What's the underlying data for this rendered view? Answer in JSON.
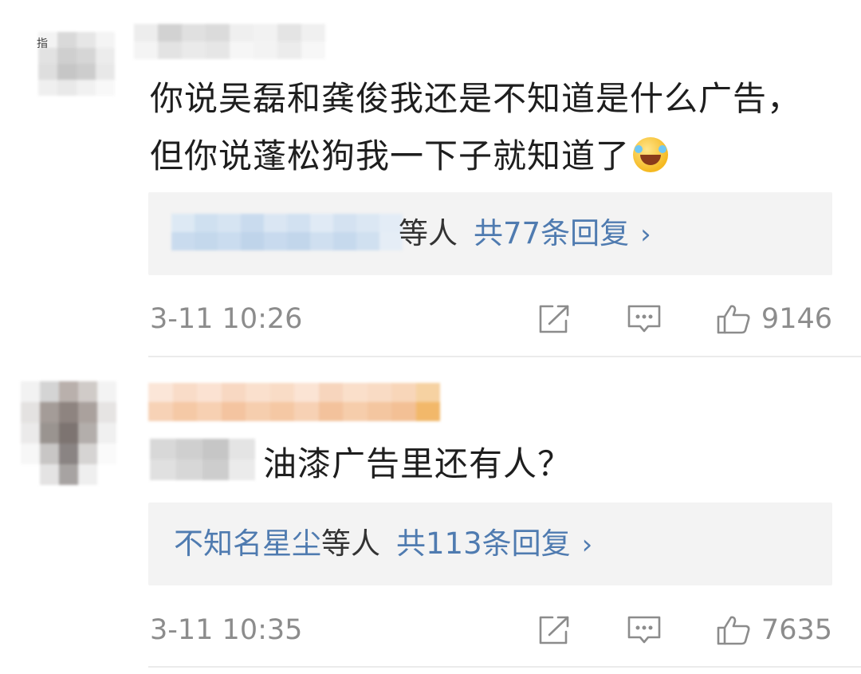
{
  "comments": [
    {
      "corner_mark": "指",
      "text": "你说吴磊和龚俊我还是不知道是什么广告，但你说蓬松狗我一下子就知道了",
      "emoji": "laughing-crying-emoji",
      "replies": {
        "name_tail": "",
        "suffix": "等人",
        "count_label": "共77条回复",
        "chevron": "›"
      },
      "time": "3-11 10:26",
      "likes": "9146"
    },
    {
      "text": "油漆广告里还有人？",
      "replies": {
        "name": "不知名星尘",
        "suffix": "等人",
        "count_label": "共113条回复",
        "chevron": "›"
      },
      "time": "3-11 10:35",
      "likes": "7635"
    }
  ],
  "icons": {
    "share": "share-icon",
    "reply": "comment-icon",
    "like": "thumbs-up-icon"
  },
  "colors": {
    "link": "#4f7bb0",
    "meta": "#8c8c8c",
    "reply_bg": "#f3f3f3",
    "text": "#1e1e1e"
  }
}
